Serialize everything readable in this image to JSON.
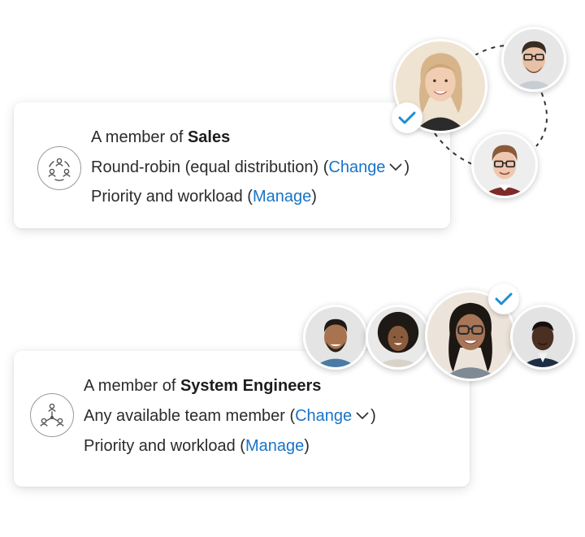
{
  "cards": [
    {
      "prefix": "A member of ",
      "team": "Sales",
      "method_prefix": "Round-robin (equal distribution) (",
      "method_link": "Change",
      "method_suffix": ")",
      "priority_prefix": "Priority and workload (",
      "priority_link": "Manage",
      "priority_suffix": ")",
      "icon": "round-robin-team-icon"
    },
    {
      "prefix": "A member of ",
      "team": "System Engineers",
      "method_prefix": "Any available team member (",
      "method_link": "Change",
      "method_suffix": ")",
      "priority_prefix": "Priority and workload (",
      "priority_link": "Manage",
      "priority_suffix": ")",
      "icon": "hub-team-icon"
    }
  ],
  "colors": {
    "link": "#1a73c7",
    "check": "#1a8fd6",
    "text": "#2b2b2b"
  },
  "icons": {
    "chevron": "chevron-down-icon",
    "check": "check-icon"
  }
}
